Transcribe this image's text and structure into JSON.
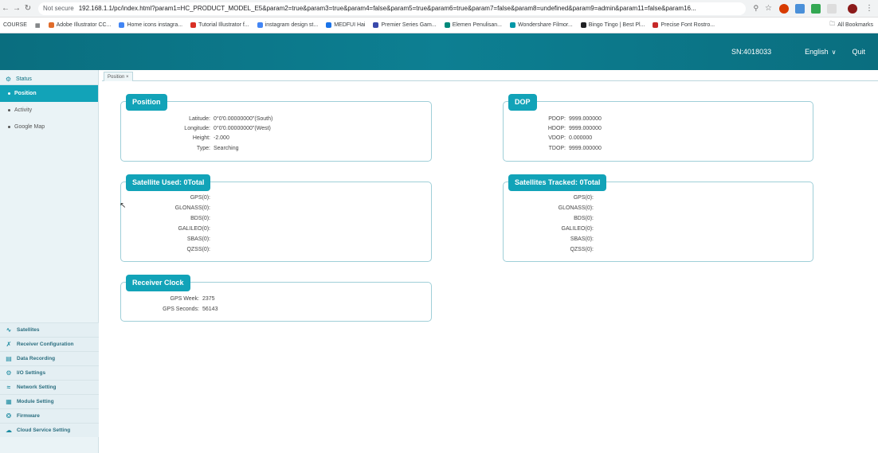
{
  "browser": {
    "not_secure": "Not secure",
    "url": "192.168.1.1/pc/index.html?param1=HC_PRODUCT_MODEL_E5&param2=true&param3=true&param4=false&param5=true&param6=true&param7=false&param8=undefined&param9=admin&param11=false&param16..."
  },
  "bookmarks": {
    "items": [
      "COURSE",
      "Adobe Illustrator CC...",
      "Home icons instagra...",
      "Tutorial Illustrator f...",
      "instagram design st...",
      "MEDFUI Hai",
      "Premier Series Gam...",
      "Elemen Penulisan...",
      "Wondershare Filmor...",
      "Bingo Tingo | Best Pl...",
      "Precise Font Rostro..."
    ],
    "all_bookmarks": "All Bookmarks"
  },
  "header": {
    "sn": "SN:4018033",
    "language": "English",
    "quit": "Quit"
  },
  "sidebar": {
    "status": "Status",
    "sub_items": [
      "Position",
      "Activity",
      "Google Map"
    ],
    "bottom_items": [
      "Satellites",
      "Receiver Configuration",
      "Data Recording",
      "I/O Settings",
      "Network Setting",
      "Module Setting",
      "Firmware",
      "Cloud Service Setting"
    ]
  },
  "tab": {
    "label": "Position ×"
  },
  "position": {
    "title": "Position",
    "rows": [
      {
        "label": "Latitude:",
        "value": "0°0'0.00000000\"(South)"
      },
      {
        "label": "Longitude:",
        "value": "0°0'0.00000000\"(West)"
      },
      {
        "label": "Height:",
        "value": "-2.000"
      },
      {
        "label": "Type:",
        "value": "Searching"
      }
    ]
  },
  "dop": {
    "title": "DOP",
    "rows": [
      {
        "label": "PDOP:",
        "value": "9999.000000"
      },
      {
        "label": "HDOP:",
        "value": "9999.000000"
      },
      {
        "label": "VDOP:",
        "value": "0.000000"
      },
      {
        "label": "TDOP:",
        "value": "9999.000000"
      }
    ]
  },
  "sat_used": {
    "title": "Satellite Used:  0Total",
    "rows": [
      "GPS(0):",
      "GLONASS(0):",
      "BDS(0):",
      "GALILEO(0):",
      "SBAS(0):",
      "QZSS(0):"
    ]
  },
  "sat_tracked": {
    "title": "Satellites Tracked:  0Total",
    "rows": [
      "GPS(0):",
      "GLONASS(0):",
      "BDS(0):",
      "GALILEO(0):",
      "SBAS(0):",
      "QZSS(0):"
    ]
  },
  "clock": {
    "title": "Receiver Clock",
    "rows": [
      {
        "label": "GPS Week:",
        "value": "2375"
      },
      {
        "label": "GPS Seconds:",
        "value": "56143"
      }
    ]
  }
}
